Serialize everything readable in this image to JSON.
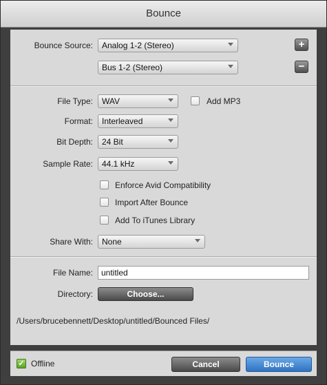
{
  "window": {
    "title": "Bounce"
  },
  "source": {
    "label": "Bounce Source:",
    "primary": "Analog 1-2 (Stereo)",
    "secondary": "Bus 1-2 (Stereo)",
    "add_glyph": "+",
    "remove_glyph": "−"
  },
  "file_type": {
    "label": "File Type:",
    "value": "WAV"
  },
  "add_mp3": {
    "label": "Add MP3",
    "checked": false
  },
  "format": {
    "label": "Format:",
    "value": "Interleaved"
  },
  "bit_depth": {
    "label": "Bit Depth:",
    "value": "24 Bit"
  },
  "sample_rate": {
    "label": "Sample Rate:",
    "value": "44.1 kHz"
  },
  "options": [
    {
      "label": "Enforce Avid Compatibility",
      "checked": false
    },
    {
      "label": "Import After Bounce",
      "checked": false
    },
    {
      "label": "Add To iTunes Library",
      "checked": false
    }
  ],
  "share_with": {
    "label": "Share With:",
    "value": "None"
  },
  "file_name": {
    "label": "File Name:",
    "value": "untitled"
  },
  "directory": {
    "label": "Directory:",
    "button": "Choose...",
    "path": "/Users/brucebennett/Desktop/untitled/Bounced Files/"
  },
  "footer": {
    "offline_label": "Offline",
    "offline_checked": true,
    "check_glyph": "✓",
    "cancel": "Cancel",
    "bounce": "Bounce"
  },
  "colors": {
    "accent": "#3a7fd0",
    "panel": "#d9d9d9",
    "frame": "#3f3f3f",
    "check_green": "#5aa12a"
  }
}
